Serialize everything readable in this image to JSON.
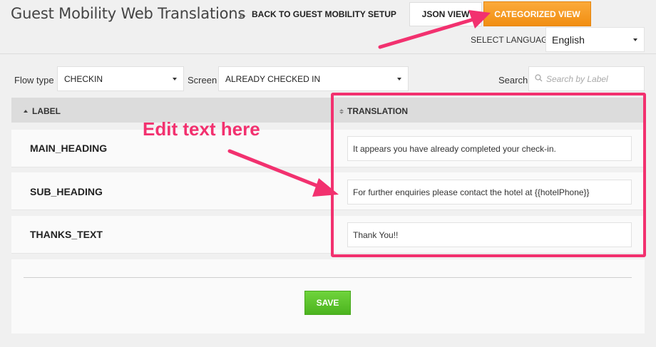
{
  "header": {
    "title": "Guest Mobility Web Translations",
    "back_link": "BACK TO GUEST MOBILITY SETUP",
    "back_icon": "left-arrow",
    "json_view_label": "JSON VIEW",
    "categorized_view_label": "CATEGORIZED VIEW"
  },
  "language": {
    "label": "SELECT LANGUAGE",
    "selected": "English"
  },
  "filters": {
    "flow_type_label": "Flow type",
    "flow_type_value": "CHECKIN",
    "screen_label": "Screen",
    "screen_value": "ALREADY CHECKED IN",
    "search_label": "Search",
    "search_placeholder": "Search by Label",
    "search_icon": "search-icon"
  },
  "table": {
    "columns": [
      "LABEL",
      "TRANSLATION"
    ],
    "rows": [
      {
        "label": "MAIN_HEADING",
        "translation": "It appears you have already completed your check-in."
      },
      {
        "label": "SUB_HEADING",
        "translation": "For further enquiries please contact the hotel at {{hotelPhone}}"
      },
      {
        "label": "THANKS_TEXT",
        "translation": "Thank You!!"
      }
    ]
  },
  "footer": {
    "save_label": "SAVE"
  },
  "annotation": {
    "text": "Edit text here",
    "color": "#f2316f"
  },
  "colors": {
    "accent_orange": "#f7a02a",
    "save_green": "#5cc02b",
    "annotation_pink": "#f2316f"
  }
}
